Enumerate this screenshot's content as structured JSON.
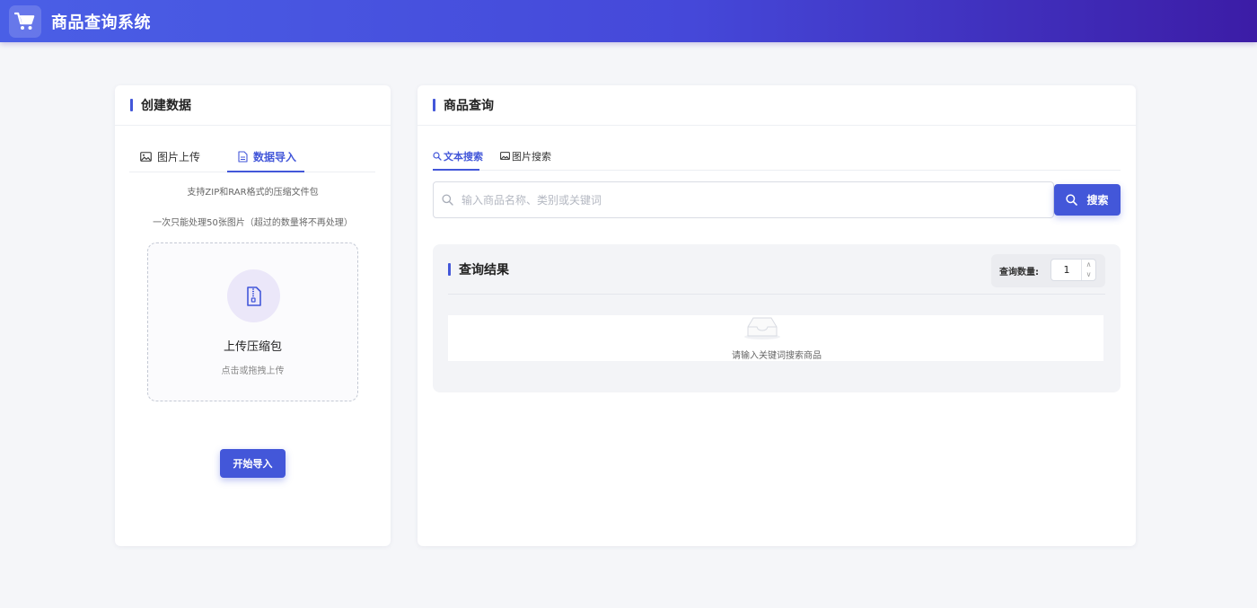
{
  "app": {
    "title": "商品查询系统",
    "logo_icon": "shopping-cart-icon"
  },
  "create_panel": {
    "title": "创建数据",
    "tabs": [
      {
        "label": "图片上传",
        "icon": "image-icon",
        "active": false
      },
      {
        "label": "数据导入",
        "icon": "document-icon",
        "active": true
      }
    ],
    "notes": [
      "支持ZIP和RAR格式的压缩文件包",
      "一次只能处理50张图片（超过的数量将不再处理）"
    ],
    "upload": {
      "icon": "zip-file-icon",
      "title": "上传压缩包",
      "subtitle": "点击或拖拽上传"
    },
    "start_button": "开始导入"
  },
  "query_panel": {
    "title": "商品查询",
    "tabs": [
      {
        "label": "文本搜索",
        "icon": "search-icon",
        "active": true
      },
      {
        "label": "图片搜索",
        "icon": "image-icon",
        "active": false
      }
    ],
    "search": {
      "value": "",
      "placeholder": "输入商品名称、类别或关键词",
      "button": "搜索"
    },
    "results": {
      "title": "查询结果",
      "count_label": "查询数量:",
      "count_value": "1",
      "empty_text": "请输入关键词搜索商品"
    }
  },
  "colors": {
    "accent": "#4357d9",
    "header_start": "#4a5fe6",
    "header_end": "#3c1ca6"
  }
}
